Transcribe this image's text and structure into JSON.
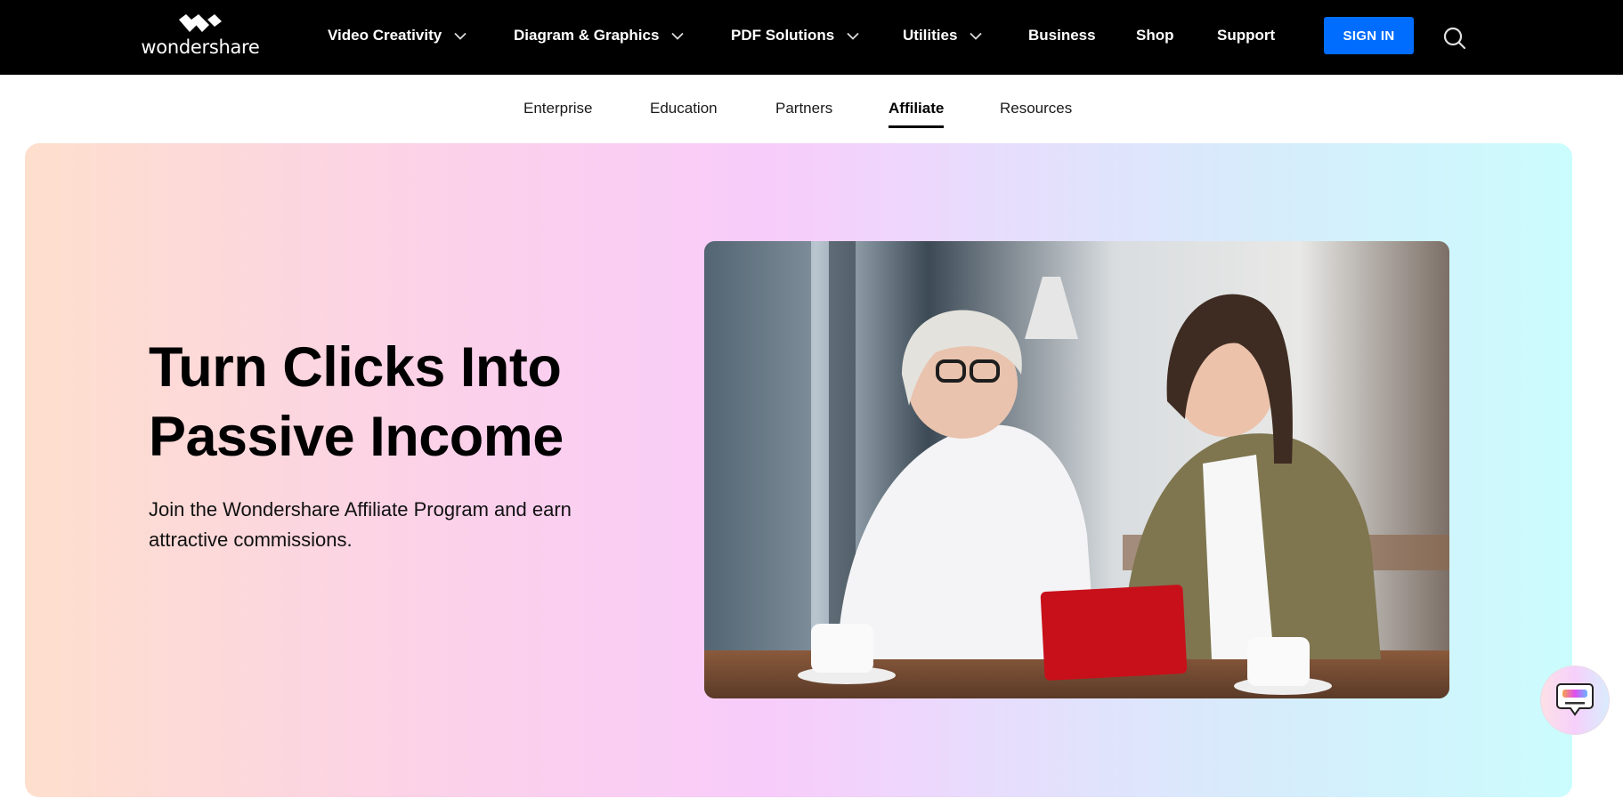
{
  "brand": {
    "name": "wondershare",
    "logo_icon": "wondershare-logo-icon"
  },
  "topnav": {
    "items": [
      {
        "label": "Video Creativity",
        "has_dropdown": true
      },
      {
        "label": "Diagram & Graphics",
        "has_dropdown": true
      },
      {
        "label": "PDF Solutions",
        "has_dropdown": true
      },
      {
        "label": "Utilities",
        "has_dropdown": true
      },
      {
        "label": "Business",
        "has_dropdown": false
      },
      {
        "label": "Shop",
        "has_dropdown": false
      },
      {
        "label": "Support",
        "has_dropdown": false
      }
    ],
    "signin_label": "SIGN IN",
    "search_icon": "search-icon"
  },
  "subnav": {
    "items": [
      {
        "label": "Enterprise",
        "active": false
      },
      {
        "label": "Education",
        "active": false
      },
      {
        "label": "Partners",
        "active": false
      },
      {
        "label": "Affiliate",
        "active": true
      },
      {
        "label": "Resources",
        "active": false
      }
    ]
  },
  "hero": {
    "title_line1": "Turn Clicks Into",
    "title_line2": "Passive Income",
    "subtitle": "Join the Wondershare Affiliate Program and earn attractive commissions.",
    "image_alt": "Two women in a cafe looking at a red tablet"
  },
  "chat": {
    "icon": "chat-bubble-icon"
  },
  "colors": {
    "nav_bg": "#000000",
    "signin_bg": "#006dff",
    "gradient_start": "#fedfcd",
    "gradient_mid": "#f8ccfa",
    "gradient_end": "#cbfcfd"
  }
}
